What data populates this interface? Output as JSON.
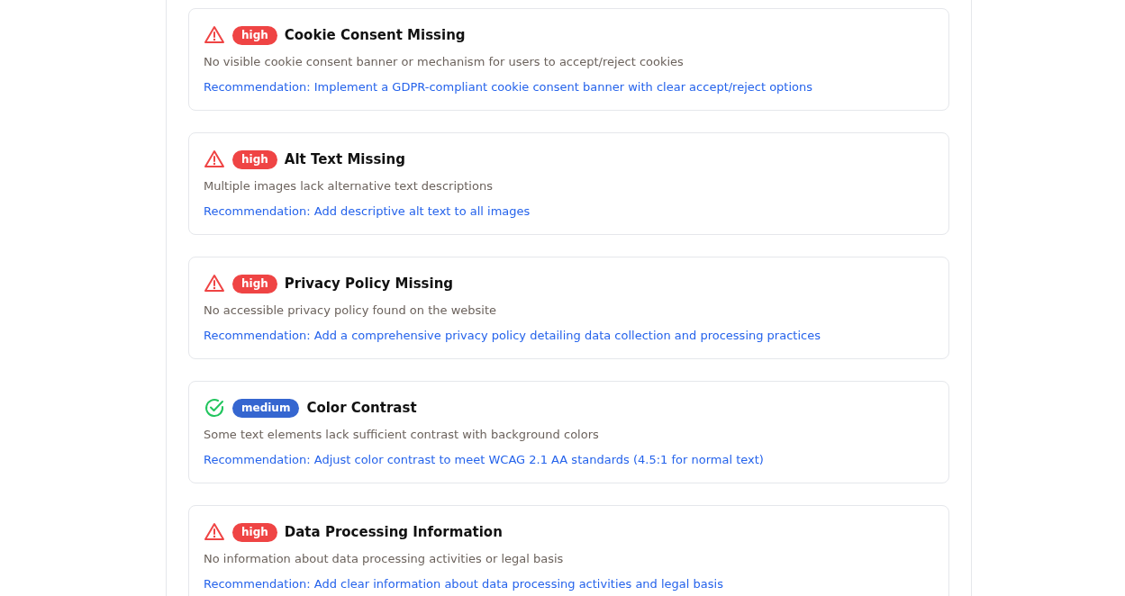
{
  "issues": [
    {
      "kind": "high",
      "badge": "high",
      "title": "Cookie Consent Missing",
      "description": "No visible cookie consent banner or mechanism for users to accept/reject cookies",
      "recommendation": "Recommendation: Implement a GDPR-compliant cookie consent banner with clear accept/reject options"
    },
    {
      "kind": "high",
      "badge": "high",
      "title": "Alt Text Missing",
      "description": "Multiple images lack alternative text descriptions",
      "recommendation": "Recommendation: Add descriptive alt text to all images"
    },
    {
      "kind": "high",
      "badge": "high",
      "title": "Privacy Policy Missing",
      "description": "No accessible privacy policy found on the website",
      "recommendation": "Recommendation: Add a comprehensive privacy policy detailing data collection and processing practices"
    },
    {
      "kind": "medium",
      "badge": "medium",
      "title": "Color Contrast",
      "description": "Some text elements lack sufficient contrast with background colors",
      "recommendation": "Recommendation: Adjust color contrast to meet WCAG 2.1 AA standards (4.5:1 for normal text)"
    },
    {
      "kind": "high",
      "badge": "high",
      "title": "Data Processing Information",
      "description": "No information about data processing activities or legal basis",
      "recommendation": "Recommendation: Add clear information about data processing activities and legal basis"
    }
  ]
}
